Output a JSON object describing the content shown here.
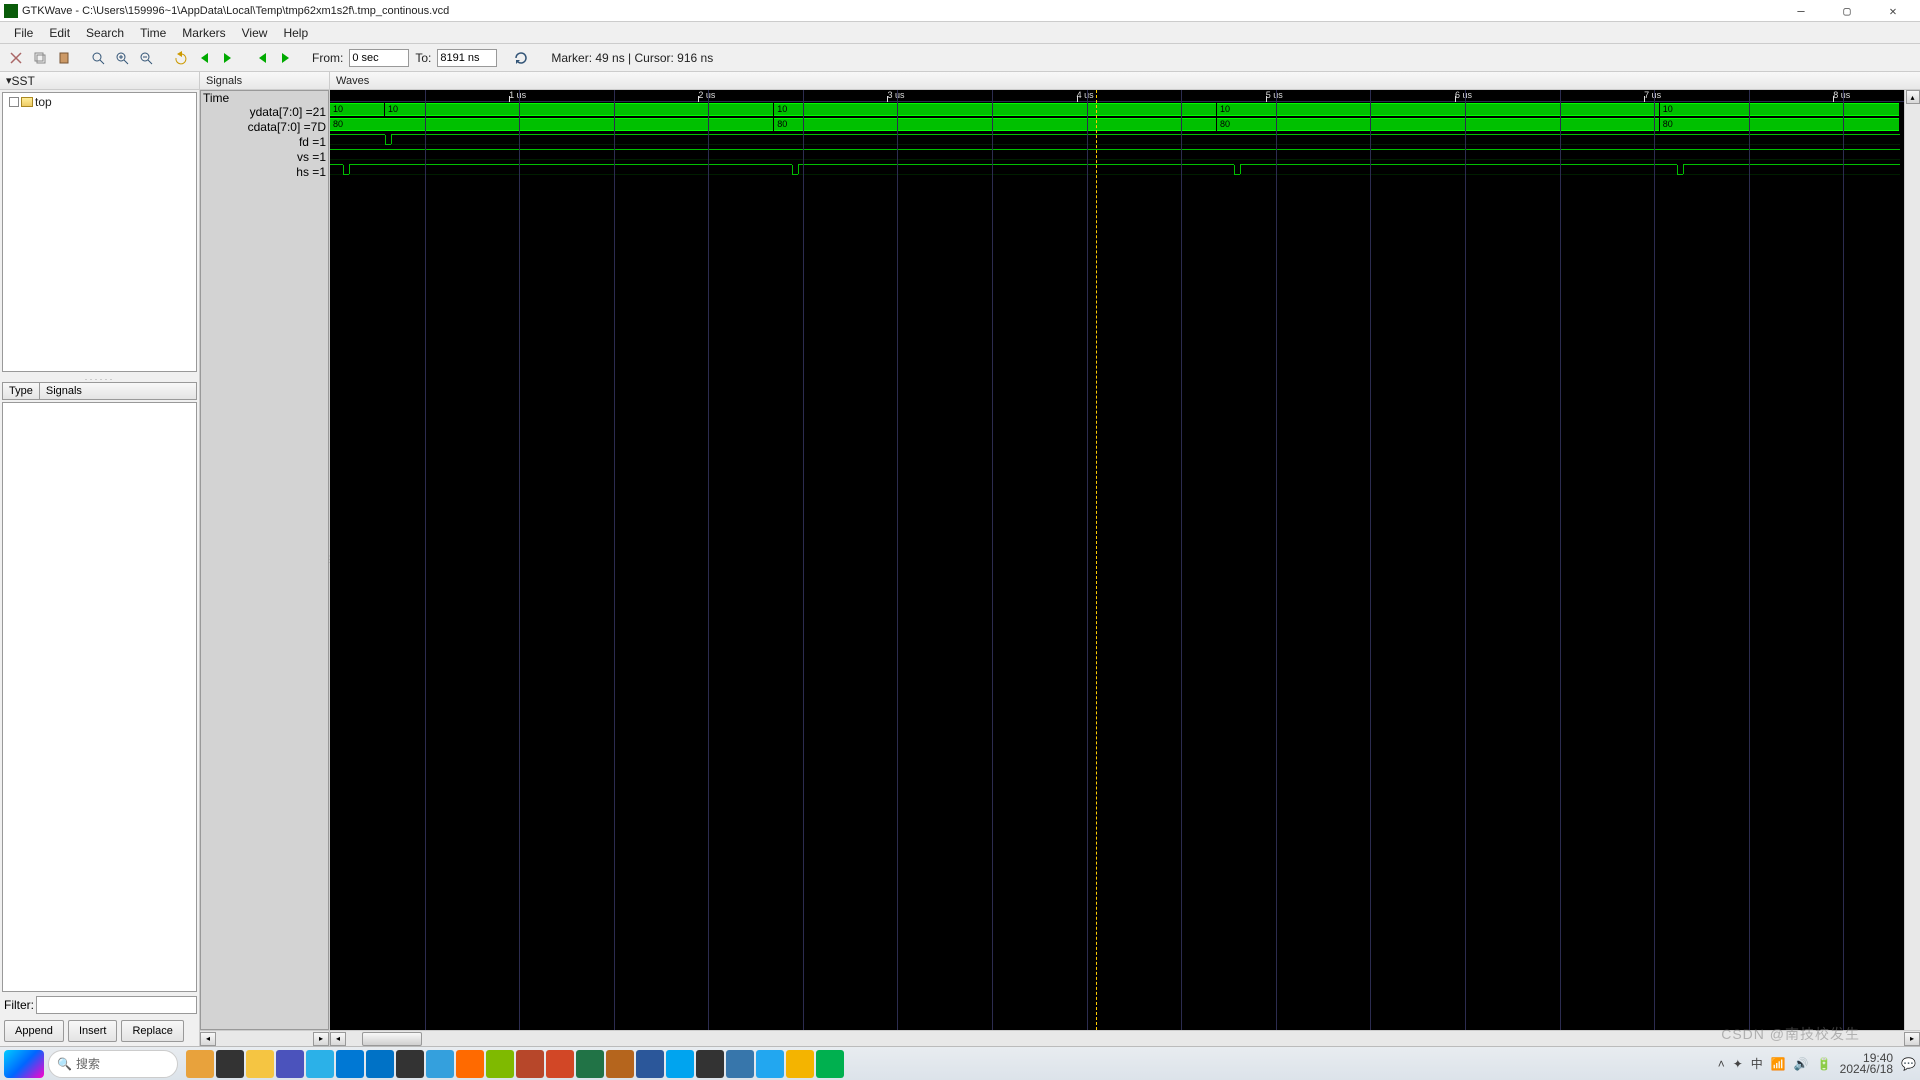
{
  "title": "GTKWave - C:\\Users\\159996~1\\AppData\\Local\\Temp\\tmp62xm1s2f\\.tmp_continous.vcd",
  "menu": [
    "File",
    "Edit",
    "Search",
    "Time",
    "Markers",
    "View",
    "Help"
  ],
  "toolbar": {
    "from_label": "From:",
    "from_val": "0 sec",
    "to_label": "To:",
    "to_val": "8191 ns",
    "status": "Marker: 49 ns  |  Cursor: 916 ns"
  },
  "panels": {
    "sst_title": "SST",
    "signals_title": "Signals",
    "waves_title": "Waves",
    "type_btn": "Type",
    "sigcol_btn": "Signals",
    "tree_root": "top",
    "time_label": "Time",
    "filter_label": "Filter:"
  },
  "buttons": {
    "append": "Append",
    "insert": "Insert",
    "replace": "Replace"
  },
  "signals": [
    {
      "name": "ydata[7:0]",
      "val": "21"
    },
    {
      "name": "cdata[7:0]",
      "val": "7D"
    },
    {
      "name": "fd",
      "val": "1"
    },
    {
      "name": "vs",
      "val": "1"
    },
    {
      "name": "hs",
      "val": "1"
    }
  ],
  "time_axis": {
    "ticks": [
      "1 us",
      "2 us",
      "3 us",
      "4 us",
      "5 us",
      "6 us",
      "7 us",
      "8 us"
    ],
    "marker_x_frac": 0.488
  },
  "bus_rows": {
    "ydata": {
      "label": "10",
      "segments_frac": [
        0.0,
        0.035,
        0.283,
        0.565,
        0.847
      ]
    },
    "cdata": {
      "label": "80",
      "segments_frac": [
        0.0,
        0.283,
        0.565,
        0.847
      ]
    }
  },
  "digital_rows": {
    "fd": {
      "high": true,
      "pulses_frac": [
        0.035
      ]
    },
    "vs": {
      "high": true,
      "pulses_frac": []
    },
    "hs": {
      "high": true,
      "pulses_frac": [
        0.008,
        0.294,
        0.576,
        0.858
      ]
    }
  },
  "taskbar": {
    "search_placeholder": "搜索",
    "icons": [
      "briefcase",
      "dark",
      "folder",
      "teams",
      "edge",
      "todo",
      "outlook",
      "obs",
      "unity",
      "files",
      "bear",
      "ppt",
      "excel",
      "rm",
      "word",
      "sync",
      "calc",
      "py",
      "vscode",
      "chrome",
      "signal",
      "wave"
    ],
    "tray": {
      "ime": "中",
      "time": "19:40",
      "date": "2024/6/18"
    }
  },
  "watermark": "CSDN @南技校发生"
}
